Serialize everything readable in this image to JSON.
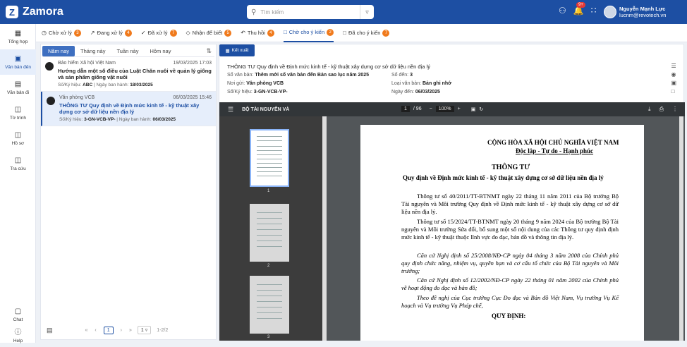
{
  "app": {
    "name": "Zamora",
    "logo_letter": "Z"
  },
  "search": {
    "placeholder": "Tìm kiếm"
  },
  "header": {
    "notifications_badge": "9+",
    "user_name": "Nguyễn Mạnh Lực",
    "user_email": "lucnm@revotech.vn"
  },
  "sidebar": {
    "items": [
      {
        "label": "Tổng hợp",
        "icon": "dashboard-icon"
      },
      {
        "label": "Văn bản đến",
        "icon": "inbox-icon"
      },
      {
        "label": "Văn bản đi",
        "icon": "outbox-icon"
      },
      {
        "label": "Tờ trình",
        "icon": "clipboard-icon"
      },
      {
        "label": "Hồ sơ",
        "icon": "folder-icon"
      },
      {
        "label": "Tra cứu",
        "icon": "folder-search-icon"
      },
      {
        "label": "Chat",
        "icon": "chat-icon"
      },
      {
        "label": "Help",
        "icon": "help-icon"
      }
    ]
  },
  "tabs": [
    {
      "label": "Chờ xử lý",
      "count": "3"
    },
    {
      "label": "Đang xử lý",
      "count": "4"
    },
    {
      "label": "Đã xử lý",
      "count": "7"
    },
    {
      "label": "Nhận để biết",
      "count": "5"
    },
    {
      "label": "Thu hồi",
      "count": "4"
    },
    {
      "label": "Chờ cho ý kiến",
      "count": "2"
    },
    {
      "label": "Đã cho ý kiến",
      "count": "7"
    }
  ],
  "filters": [
    "Năm nay",
    "Tháng này",
    "Tuần này",
    "Hôm nay"
  ],
  "list": [
    {
      "org": "Bảo hiểm Xã hội Việt Nam",
      "time": "19/03/2025 17:03",
      "title": "Hướng dẫn một số điều của Luật Chăn nuôi về quản lý giống và sản phẩm giống vật nuôi",
      "code_label": "Số/Ký hiệu:",
      "code": "ABC",
      "date_label": "Ngày ban hành:",
      "date": "18/03/2025"
    },
    {
      "org": "Văn phòng VCB",
      "time": "06/03/2025 15:46",
      "title": "THÔNG TƯ Quy định về Định mức kinh tế - kỹ thuật xây dựng cơ sở dữ liệu nền địa lý",
      "code_label": "Số/Ký hiệu:",
      "code": "3-GN-VCB-VP-",
      "date_label": "Ngày ban hành:",
      "date": "06/03/2025"
    }
  ],
  "pager": {
    "current": "1",
    "page_size": "1",
    "info": "1-2/2"
  },
  "detail": {
    "export_label": "Kết xuất",
    "title": "THÔNG TƯ Quy định về Định mức kinh tế - kỹ thuật xây dựng cơ sở dữ liệu nền địa lý",
    "so_van_ban_label": "Sổ văn bản:",
    "so_van_ban": "Thêm mới sổ văn bản đến Bản sao lục năm 2025",
    "so_den_label": "Số đến:",
    "so_den": "3",
    "noi_gui_label": "Nơi gửi:",
    "noi_gui": "Văn phòng VCB",
    "loai_label": "Loại văn bản:",
    "loai": "Bản ghi nhớ",
    "ky_hieu_label": "Số/Ký hiệu:",
    "ky_hieu": "3-GN-VCB-VP-",
    "ngay_den_label": "Ngày đến:",
    "ngay_den": "06/03/2025"
  },
  "viewer": {
    "doc_title": "BỘ TÀI NGUYÊN VÀ",
    "page_current": "1",
    "page_total": "/ 96",
    "zoom": "100%",
    "thumb_labels": [
      "1",
      "2",
      "3"
    ]
  },
  "document": {
    "national": "CỘNG HÒA XÃ HỘI CHỦ NGHĨA VIỆT NAM",
    "motto": "Độc lập - Tự do - Hạnh phúc",
    "type": "THÔNG TƯ",
    "subject": "Quy định về Định mức kinh tế - kỹ thuật xây dựng cơ sở dữ liệu nền địa lý",
    "para1": "Thông tư số 40/2011/TT-BTNMT ngày 22 tháng 11 năm 2011 của Bộ trưởng Bộ Tài nguyên và Môi trường Quy định về Định mức kinh tế - kỹ thuật xây dựng cơ sở dữ liệu nền địa lý.",
    "para2": "Thông tư số 15/2024/TT-BTNMT ngày 20 tháng 9 năm 2024 của Bộ trưởng Bộ Tài nguyên và Môi trường Sửa đổi, bổ sung một số nội dung của các Thông tư quy định định mức kinh tế - kỹ thuật thuộc lĩnh vực đo đạc, bản đồ và thông tin địa lý.",
    "para3": "Căn cứ Nghị định số 25/2008/NĐ-CP ngày 04 tháng 3 năm 2008 của Chính phủ quy định chức năng, nhiệm vụ, quyền hạn và cơ cấu tổ chức của Bộ Tài nguyên và Môi trường;",
    "para4": "Căn cứ Nghị định số 12/2002/NĐ-CP ngày 22 tháng 01 năm 2002 của Chính phủ về hoạt động đo đạc và bản đồ;",
    "para5": "Theo đề nghị của Cục trưởng Cục Đo đạc và Bản đồ Việt Nam, Vụ trưởng Vụ Kế hoạch và Vụ trưởng Vụ Pháp chế,",
    "decide": "QUY ĐỊNH:"
  }
}
